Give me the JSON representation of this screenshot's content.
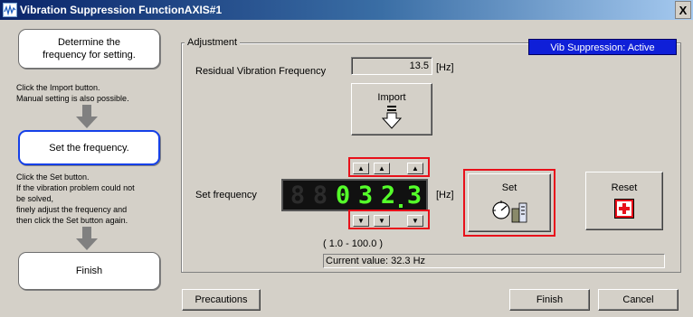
{
  "window": {
    "title": "Vibration Suppression FunctionAXIS#1",
    "close_glyph": "X"
  },
  "flow": {
    "steps": [
      {
        "label": "Determine the frequency for setting.",
        "active": false
      },
      {
        "label": "Set the frequency.",
        "active": true
      },
      {
        "label": "Finish",
        "active": false
      }
    ],
    "notes": [
      [
        "Click the Import button.",
        "Manual setting is also possible."
      ],
      [
        "Click the Set button.",
        "If the vibration problem could not",
        "be solved,",
        "finely adjust the frequency and",
        "then click the Set button again."
      ]
    ]
  },
  "adjustment": {
    "legend": "Adjustment",
    "status": "Vib Suppression: Active",
    "residual_label": "Residual Vibration Frequency",
    "residual_value": "13.5",
    "residual_unit": "[Hz]",
    "import_label": "Import",
    "set_frequency_label": "Set frequency",
    "display_digits": [
      "8",
      "8",
      "0",
      "3",
      "2",
      "3"
    ],
    "display_dim": [
      true,
      true,
      false,
      false,
      false,
      false
    ],
    "set_frequency_unit": "[Hz]",
    "set_label": "Set",
    "reset_label": "Reset",
    "range": "( 1.0 - 100.0 )",
    "current_value": "Current value:  32.3 Hz"
  },
  "footer": {
    "precautions_label": "Precautions",
    "finish_label": "Finish",
    "cancel_label": "Cancel"
  },
  "icons": {
    "import": "import-arrow-icon",
    "set": "set-dial-icon",
    "reset": "reset-cross-icon",
    "step_arrow": "arrow-down-icon"
  },
  "colors": {
    "highlight": "#e8101a",
    "status_bg": "#0f1fd8",
    "digit": "#55ff2a",
    "active_step": "#1540e8"
  }
}
